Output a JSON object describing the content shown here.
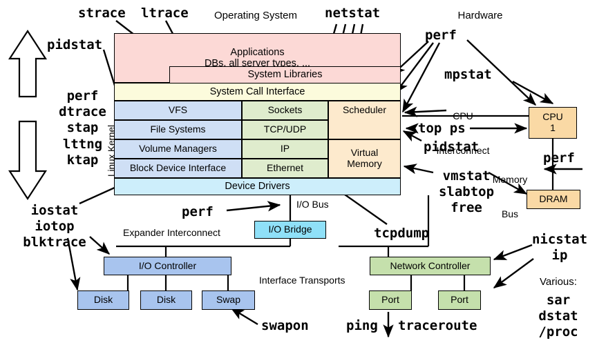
{
  "headers": {
    "operating_system": "Operating System",
    "hardware": "Hardware",
    "linux_kernel": "Linux Kernel"
  },
  "stack": {
    "applications_line1": "Applications",
    "applications_line2": "DBs, all server types, ...",
    "system_libraries": "System Libraries",
    "system_call_interface": "System Call Interface",
    "vfs": "VFS",
    "file_systems": "File Systems",
    "volume_managers": "Volume Managers",
    "block_device_interface": "Block Device Interface",
    "sockets": "Sockets",
    "tcp_udp": "TCP/UDP",
    "ip": "IP",
    "ethernet": "Ethernet",
    "scheduler": "Scheduler",
    "virtual_memory_line1": "Virtual",
    "virtual_memory_line2": "Memory",
    "device_drivers": "Device Drivers"
  },
  "hardware": {
    "cpu_line1": "CPU",
    "cpu_line2": "1",
    "dram": "DRAM",
    "cpu_interconnect_line1": "CPU",
    "cpu_interconnect_line2": "Interconnect",
    "memory_bus_line1": "Memory",
    "memory_bus_line2": "Bus",
    "io_bus": "I/O Bus",
    "io_bridge": "I/O Bridge",
    "expander_interconnect": "Expander Interconnect",
    "interface_transports": "Interface Transports",
    "io_controller": "I/O Controller",
    "disk_1": "Disk",
    "disk_2": "Disk",
    "swap": "Swap",
    "network_controller": "Network Controller",
    "port_1": "Port",
    "port_2": "Port"
  },
  "tools": {
    "strace": "strace",
    "ltrace": "ltrace",
    "netstat": "netstat",
    "pidstat_top": "pidstat",
    "perf_hw": "perf",
    "mpstat": "mpstat",
    "top_ps": "top ps",
    "pidstat_mid": "pidstat",
    "perf_mem": "perf",
    "vmstat_group": "vmstat\nslabtop\nfree",
    "dynamic_group": "perf\ndtrace\nstap\nlttng\nktap",
    "iostat_group": "iostat\niotop\nblktrace",
    "perf_io": "perf",
    "tcpdump": "tcpdump",
    "swapon": "swapon",
    "ping": "ping",
    "traceroute": "traceroute",
    "nicstat_group": "nicstat\nip",
    "various_label": "Various:",
    "various_group": "sar\ndstat\n/proc"
  },
  "colors": {
    "pink": "#fcd9d6",
    "yellow": "#fcfbdc",
    "blue": "#cfdff5",
    "green": "#dfeccd",
    "orange": "#fdeacd",
    "cyan_light": "#cdeefb",
    "cyan_bright": "#8fe0f8",
    "blue_mid": "#a8c4ee",
    "green_mid": "#c5e0ac",
    "orange_mid": "#fad9a5",
    "stroke": "#000000"
  }
}
